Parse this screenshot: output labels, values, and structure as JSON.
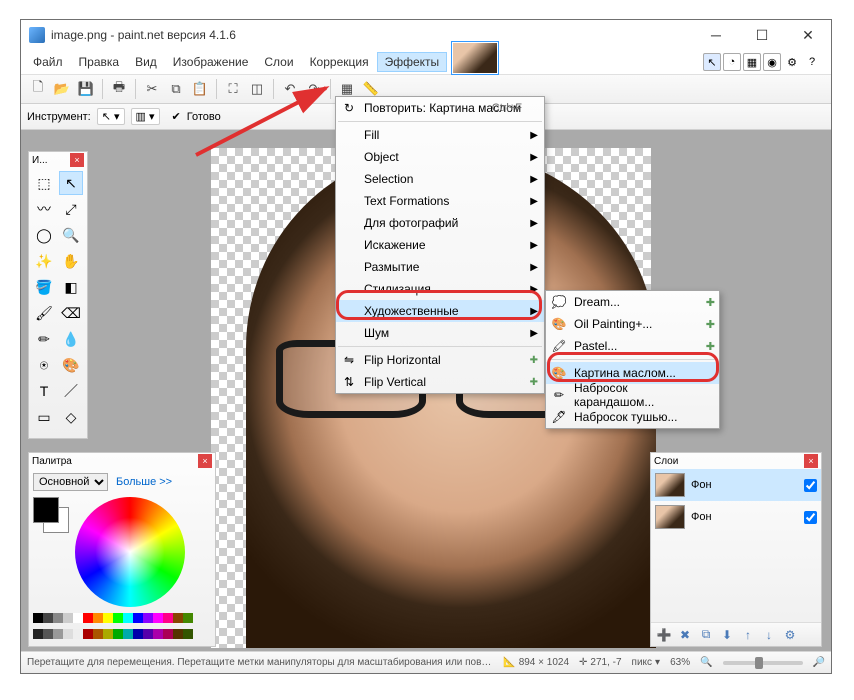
{
  "titlebar": {
    "title": "image.png - paint.net версия 4.1.6"
  },
  "menubar": {
    "items": [
      "Файл",
      "Правка",
      "Вид",
      "Изображение",
      "Слои",
      "Коррекция",
      "Эффекты"
    ]
  },
  "toolbar2": {
    "label": "Инструмент:",
    "status": "Готово"
  },
  "tools_panel": {
    "title": "И..."
  },
  "palette_panel": {
    "title": "Палитра",
    "dropdown": "Основной",
    "more": "Больше >>"
  },
  "layers_panel": {
    "title": "Слои",
    "layers": [
      {
        "name": "Фон",
        "checked": true
      },
      {
        "name": "Фон",
        "checked": true
      }
    ]
  },
  "effects_menu": {
    "repeat_label": "Повторить: Картина маслом",
    "repeat_shortcut": "Ctrl+F",
    "items": [
      "Fill",
      "Object",
      "Selection",
      "Text Formations",
      "Для фотографий",
      "Искажение",
      "Размытие",
      "Стилизация"
    ],
    "artistic": "Художественные",
    "noise": "Шум",
    "flip_h": "Flip Horizontal",
    "flip_v": "Flip Vertical"
  },
  "artistic_menu": {
    "items": [
      "Dream...",
      "Oil Painting+...",
      "Pastel..."
    ],
    "oil": "Картина маслом...",
    "pencil": "Набросок карандашом...",
    "ink": "Набросок тушью..."
  },
  "statusbar": {
    "hint": "Перетащите для перемещения. Перетащите метки манипуляторы для масштабирования или поворота. Удерживайте Shift для огранич...",
    "dims": "894 × 1024",
    "cursor": "271, -7",
    "units": "пикс",
    "zoom": "63%"
  }
}
